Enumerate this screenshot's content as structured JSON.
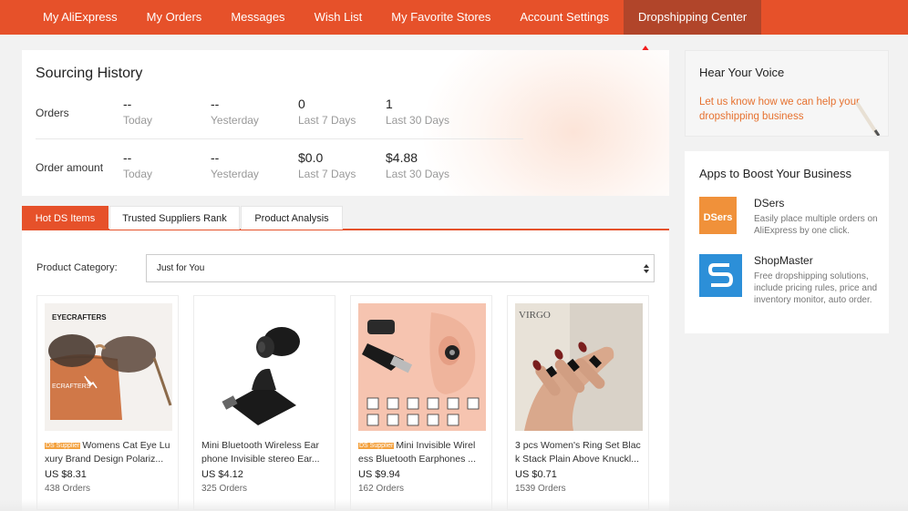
{
  "nav": {
    "items": [
      {
        "label": "My AliExpress"
      },
      {
        "label": "My Orders"
      },
      {
        "label": "Messages"
      },
      {
        "label": "Wish List"
      },
      {
        "label": "My Favorite Stores"
      },
      {
        "label": "Account Settings"
      },
      {
        "label": "Dropshipping Center",
        "active": true
      }
    ],
    "accent": "#e6512a",
    "active_bg": "#b1452a",
    "annotation": "red-arrow-icon"
  },
  "sourcing": {
    "title": "Sourcing History",
    "rows": [
      {
        "label": "Orders",
        "stats": [
          {
            "value": "--",
            "period": "Today"
          },
          {
            "value": "--",
            "period": "Yesterday"
          },
          {
            "value": "0",
            "period": "Last 7 Days"
          },
          {
            "value": "1",
            "period": "Last 30 Days"
          }
        ]
      },
      {
        "label": "Order amount",
        "stats": [
          {
            "value": "--",
            "period": "Today"
          },
          {
            "value": "--",
            "period": "Yesterday"
          },
          {
            "value": "$0.0",
            "period": "Last 7 Days"
          },
          {
            "value": "$4.88",
            "period": "Last 30 Days"
          }
        ]
      }
    ]
  },
  "tabs": [
    {
      "label": "Hot DS Items",
      "active": true
    },
    {
      "label": "Trusted Suppliers Rank"
    },
    {
      "label": "Product Analysis"
    }
  ],
  "filter": {
    "label": "Product Category:",
    "selected": "Just for You"
  },
  "products": [
    {
      "badge": "DS Supplier",
      "title_line1": "Womens Cat Eye Lu",
      "title_line2": "xury Brand Design Polariz...",
      "price": "US $8.31",
      "orders": "438 Orders",
      "brand_text": "EYECRAFTERS",
      "case_text": "ECRAFTERS"
    },
    {
      "badge": "",
      "title_line1": "Mini Bluetooth Wireless Ear",
      "title_line2": "phone Invisible stereo Ear...",
      "price": "US $4.12",
      "orders": "325 Orders"
    },
    {
      "badge": "DS Supplier",
      "title_line1": "Mini Invisible Wirel",
      "title_line2": "ess Bluetooth Earphones ...",
      "price": "US $9.94",
      "orders": "162 Orders"
    },
    {
      "badge": "",
      "title_line1": "3 pcs Women's Ring Set Blac",
      "title_line2": "k Stack Plain Above Knuckl...",
      "price": "US $0.71",
      "orders": "1539 Orders",
      "photo_text": "VIRGO"
    }
  ],
  "voice": {
    "title": "Hear Your Voice",
    "subtitle": "Let us know how we can help your dropshipping business"
  },
  "apps": {
    "title": "Apps to Boost Your Business",
    "items": [
      {
        "name": "DSers",
        "logo_text": "DSers",
        "logo_color": "#f0913a",
        "desc": "Easily place multiple orders on AliExpress by one click."
      },
      {
        "name": "ShopMaster",
        "logo_text": "S",
        "logo_color": "#2c8fd8",
        "desc": "Free dropshipping solutions, include pricing rules, price and inventory monitor, auto order."
      }
    ]
  }
}
